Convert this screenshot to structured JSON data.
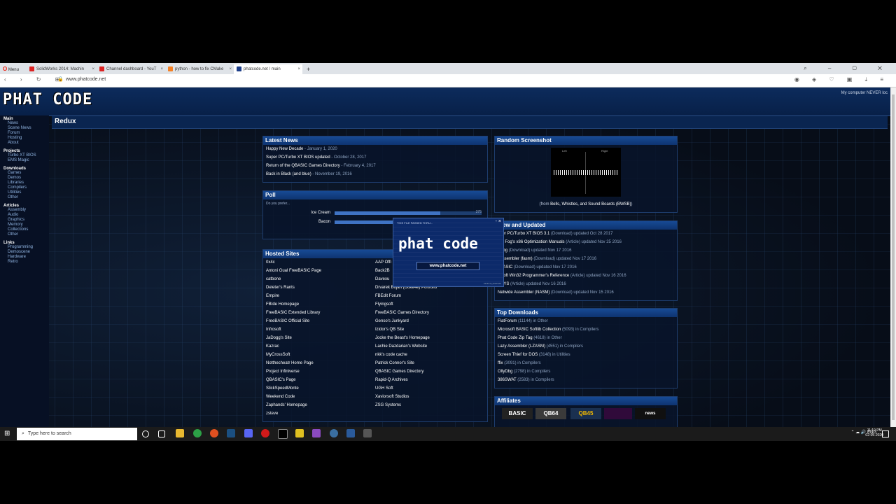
{
  "browser": {
    "menu_label": "Menu",
    "tabs": [
      {
        "label": "SolidWorks 2014: Machin",
        "icon": "youtube-icon"
      },
      {
        "label": "Channel dashboard - YouT",
        "icon": "youtube-icon"
      },
      {
        "label": "python - how to fix CMake",
        "icon": "stackoverflow-icon"
      },
      {
        "label": "phatcode.net / main",
        "icon": "phatcode-icon",
        "active": true
      }
    ],
    "new_tab": "+",
    "url": "www.phatcode.net"
  },
  "site": {
    "logo": "PHAT CODE",
    "header_note": "My computer NEVER loc",
    "page_title": "Redux",
    "sidebar": [
      {
        "section": "Main",
        "links": [
          "News",
          "Scene News",
          "Forum",
          "Hosting",
          "About"
        ]
      },
      {
        "section": "Projects",
        "links": [
          "Turbo XT BIOS",
          "EMS Magic"
        ]
      },
      {
        "section": "Downloads",
        "links": [
          "Games",
          "Demos",
          "Libraries",
          "Compilers",
          "Utilities",
          "Other"
        ]
      },
      {
        "section": "Articles",
        "links": [
          "Assembly",
          "Audio",
          "Graphics",
          "Memory",
          "Collections",
          "Other"
        ]
      },
      {
        "section": "Links",
        "links": [
          "Programming",
          "Demoscene",
          "Hardware",
          "Retro"
        ]
      }
    ],
    "latest_news": {
      "title": "Latest News",
      "items": [
        {
          "title": "Happy New Decade",
          "date": " - January 1, 2020"
        },
        {
          "title": "Super PC/Turbo XT BIOS updated",
          "date": " - October 28, 2017"
        },
        {
          "title": "Return of the QBASIC Games Directory",
          "date": " - February 4, 2017"
        },
        {
          "title": "Back in Black (and blue)",
          "date": " - November 19, 2016"
        }
      ]
    },
    "poll": {
      "title": "Poll",
      "question": "Do you prefer...",
      "options": [
        {
          "label": "Ice Cream",
          "count": "375",
          "fraction": 0.72
        },
        {
          "label": "Bacon",
          "count": "",
          "fraction": 0.4
        }
      ]
    },
    "hosted_sites": {
      "title": "Hosted Sites",
      "left": [
        "0x4c",
        "Antoni Gual FreeBASIC Page",
        "catbone",
        "Deleter's Rants",
        "Empire",
        "FBIde Homepage",
        "FreeBASIC Extended Library",
        "FreeBASIC Official Site",
        "Infrosoft",
        "JaDogg's Site",
        "Kazrac",
        "MyCrossSoft",
        "Notthecheatr Home Page",
        "Project Infiniverse",
        "QBASIC's Page",
        "SlickSpeedMonte",
        "Weekend Code",
        "Zaphands' Homepage",
        "zsteve"
      ],
      "right": [
        "AAP Offi",
        "Back2B",
        "Davexu",
        "Drvarek Bojan (Duke4e) Portfolio",
        "FBEdit Forum",
        "Flyingsoft",
        "FreeBASIC Games Directory",
        "Genso's Junkyard",
        "Izidor's QB Site",
        "Jocke the Beast's Homepage",
        "Lachie Dazdarian's Website",
        "nkk's code cache",
        "Patrick Connor's Site",
        "QBASIC Games Directory",
        "Rapid-Q Archives",
        "UGH Soft",
        "Xaviorsoft Studios",
        "ZSG Systems"
      ]
    },
    "random_screenshot": {
      "title": "Random Screenshot",
      "caption_prefix": "(from ",
      "caption_link": "Bells, Whistles, and Sound Boards (BWSB)",
      "caption_suffix": ")",
      "image_labels": [
        "Left",
        "Right"
      ]
    },
    "new_updated": {
      "title": "New and Updated",
      "title_visible": "ew and Updated",
      "items": [
        {
          "name": "uper PC/Turbo XT BIOS 3.1",
          "meta": " (Download) updated Oct 28 2017"
        },
        {
          "name": "ner Fog's x86 Optimization Manuals",
          "meta": " (Article) updated Nov 25 2016"
        },
        {
          "name": "yDbg",
          "meta": " (Download) updated Nov 17 2016"
        },
        {
          "name": "t assembler (fasm)",
          "meta": " (Download) updated Nov 17 2016"
        },
        {
          "name": "eBASIC",
          "meta": " (Download) updated Nov 17 2016"
        },
        {
          "name": "rosoft Win32 Programmer's Reference",
          "meta": " (Article) updated Nov 16 2016"
        },
        {
          "name": "DSYS",
          "meta": " (Article) updated Nov 16 2016"
        },
        {
          "name": "Netwide Assembler (NASM)",
          "meta": " (Download) updated Nov 15 2016"
        }
      ]
    },
    "top_downloads": {
      "title": "Top Downloads",
      "items": [
        {
          "name": "FlatForum",
          "meta": " (11144) in Other"
        },
        {
          "name": "Microsoft BASIC Softlib Collection",
          "meta": " (5093) in Compilers"
        },
        {
          "name": "Phat Code Zip Tag",
          "meta": " (4618) in Other"
        },
        {
          "name": "Lazy Assembler (LZASM)",
          "meta": " (4551) in Compilers"
        },
        {
          "name": "Screen Thief for DOS",
          "meta": " (3148) in Utilities"
        },
        {
          "name": "ffix",
          "meta": " (3091) in Compilers"
        },
        {
          "name": "OllyDbg",
          "meta": " (2798) in Compilers"
        },
        {
          "name": "386SWAT",
          "meta": " (2583) in Compilers"
        }
      ]
    },
    "affiliates": {
      "title": "Affiliates",
      "badges": [
        {
          "label": "BASIC",
          "color": "#ffffff",
          "bg": "#222222"
        },
        {
          "label": "QB64",
          "color": "#ffffff",
          "bg": "#3a3a3a"
        },
        {
          "label": "QB45",
          "color": "#f0b800",
          "bg": "#1a3050"
        },
        {
          "label": "",
          "color": "#ff4040",
          "bg": "#300a3a"
        },
        {
          "label": "news",
          "color": "#ffffff",
          "bg": "#101010"
        }
      ]
    }
  },
  "popup": {
    "small_text": "THIS FILE PASSED THRU...",
    "big_text": "phat code",
    "url": "www.phatcode.net",
    "by": "tracks by phatcode",
    "controls": "- ×"
  },
  "taskbar": {
    "search_placeholder": "Type here to search",
    "tray_lang": "ENG",
    "time": "11:10 PM",
    "date": "02-05-2020"
  }
}
